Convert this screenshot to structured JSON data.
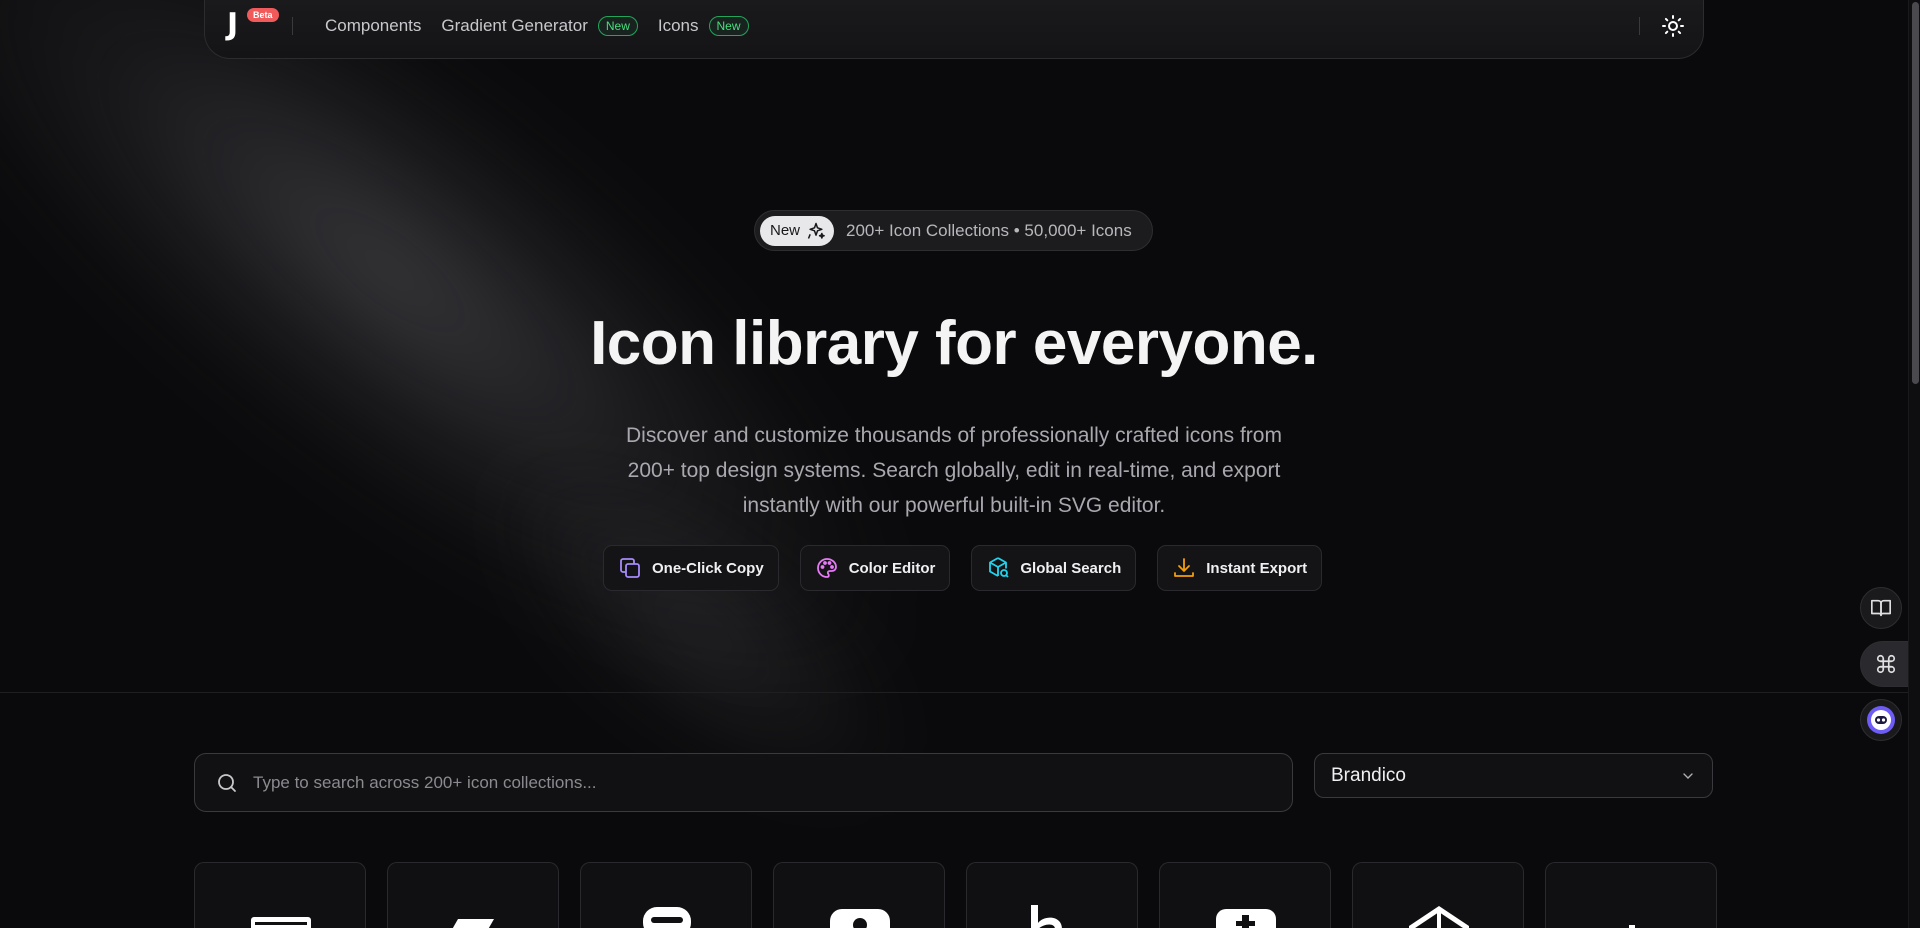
{
  "nav": {
    "logo_letter": "J",
    "beta_label": "Beta",
    "links": [
      {
        "label": "Components",
        "badge": ""
      },
      {
        "label": "Gradient Generator",
        "badge": "New"
      },
      {
        "label": "Icons",
        "badge": "New"
      }
    ],
    "theme_icon": "sun-icon"
  },
  "hero": {
    "pill_badge": "New",
    "pill_icon": "sparkles-icon",
    "pill_text": "200+ Icon Collections • 50,000+ Icons",
    "title": "Icon library for everyone.",
    "subtitle": "Discover and customize thousands of professionally crafted icons from 200+ top design systems. Search globally, edit in real-time, and export instantly with our powerful built-in SVG editor.",
    "features": [
      {
        "label": "One-Click Copy",
        "icon": "copy-icon",
        "color": "#a78bfa"
      },
      {
        "label": "Color Editor",
        "icon": "palette-icon",
        "color": "#e879f9"
      },
      {
        "label": "Global Search",
        "icon": "search-cube-icon",
        "color": "#22d3ee"
      },
      {
        "label": "Instant Export",
        "icon": "download-icon",
        "color": "#f59e0b"
      }
    ]
  },
  "search": {
    "placeholder": "Type to search across 200+ icon collections...",
    "value": ""
  },
  "collection_select": {
    "selected": "Brandico"
  },
  "floating": {
    "buttons": [
      "book-icon",
      "command-icon",
      "bot-icon"
    ]
  },
  "colors": {
    "background": "#0a0a0c",
    "accent_green": "#4ade80",
    "beta_red": "#f05a5a"
  }
}
